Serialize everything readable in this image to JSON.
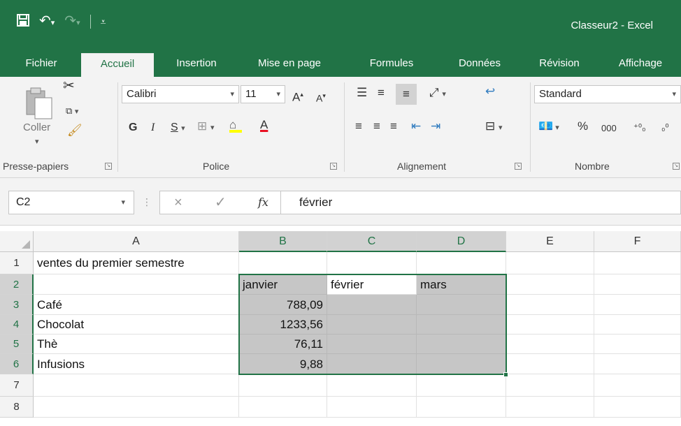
{
  "window": {
    "title": "Classeur2 - Excel"
  },
  "qat": {
    "save_icon": "save-icon",
    "undo_icon": "undo-icon",
    "redo_icon": "redo-icon",
    "customize_icon": "customize-qat-icon"
  },
  "tabs": [
    {
      "label": "Fichier"
    },
    {
      "label": "Accueil"
    },
    {
      "label": "Insertion"
    },
    {
      "label": "Mise en page"
    },
    {
      "label": "Formules"
    },
    {
      "label": "Données"
    },
    {
      "label": "Révision"
    },
    {
      "label": "Affichage"
    }
  ],
  "ribbon": {
    "clipboard": {
      "paste_label": "Coller",
      "group_label": "Presse-papiers"
    },
    "font": {
      "font_name": "Calibri",
      "font_size": "11",
      "bold": "G",
      "italic": "I",
      "underline": "S",
      "group_label": "Police"
    },
    "alignment": {
      "group_label": "Alignement"
    },
    "number": {
      "format": "Standard",
      "percent": "%",
      "thousands": "000",
      "group_label": "Nombre"
    }
  },
  "formula_bar": {
    "name_box": "C2",
    "cancel": "×",
    "enter": "✓",
    "fx": "fx",
    "content": "février"
  },
  "grid": {
    "columns": [
      "A",
      "B",
      "C",
      "D",
      "E",
      "F"
    ],
    "rows": [
      "1",
      "2",
      "3",
      "4",
      "5",
      "6",
      "7",
      "8"
    ],
    "cells": {
      "A1": "ventes du premier semestre",
      "B2": "janvier",
      "C2": "février",
      "D2": "mars",
      "A3": "Café",
      "B3": "788,09",
      "A4": "Chocolat",
      "B4": "1233,56",
      "A5": "Thè",
      "B5": "76,11",
      "A6": "Infusions",
      "B6": "9,88"
    },
    "active_cell": "C2",
    "selected_range": "B2:D6"
  },
  "colors": {
    "accent": "#217346",
    "selection": "#c6c6c6"
  }
}
